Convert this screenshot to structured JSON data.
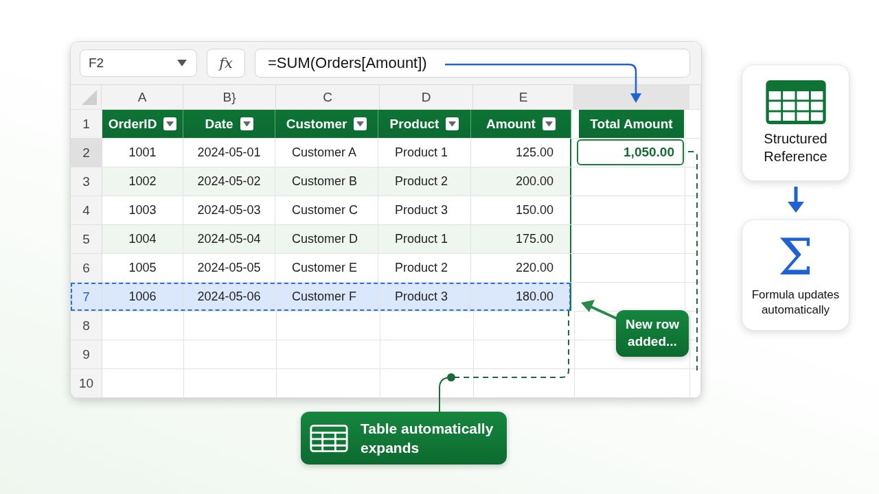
{
  "name_box": {
    "value": "F2"
  },
  "formula_bar": {
    "fx": "fx",
    "formula": "=SUM(Orders[Amount])"
  },
  "column_letters": [
    "A",
    "B}",
    "C",
    "D",
    "E"
  ],
  "table": {
    "header_row": "1",
    "headers": [
      "OrderID",
      "Date",
      "Customer",
      "Product",
      "Amount"
    ],
    "rows": [
      {
        "row": "2",
        "selected": true,
        "new": false,
        "cells": [
          "1001",
          "2024-05-01",
          "Customer A",
          "Product 1",
          "125.00"
        ]
      },
      {
        "row": "3",
        "selected": false,
        "new": false,
        "cells": [
          "1002",
          "2024-05-02",
          "Customer B",
          "Product 2",
          "200.00"
        ]
      },
      {
        "row": "4",
        "selected": false,
        "new": false,
        "cells": [
          "1003",
          "2024-05-03",
          "Customer C",
          "Product 3",
          "150.00"
        ]
      },
      {
        "row": "5",
        "selected": false,
        "new": false,
        "cells": [
          "1004",
          "2024-05-04",
          "Customer D",
          "Product 1",
          "175.00"
        ]
      },
      {
        "row": "6",
        "selected": false,
        "new": false,
        "cells": [
          "1005",
          "2024-05-05",
          "Customer E",
          "Product 2",
          "220.00"
        ]
      },
      {
        "row": "7",
        "selected": false,
        "new": true,
        "cells": [
          "1006",
          "2024-05-06",
          "Customer F",
          "Product 3",
          "180.00"
        ]
      }
    ]
  },
  "empty_rows": [
    "8",
    "9",
    "10"
  ],
  "total": {
    "header": "Total Amount",
    "value": "1,050.00"
  },
  "callouts": {
    "new_row": "New row added...",
    "expands": "Table automatically expands"
  },
  "cards": [
    {
      "kind": "table",
      "label": "Structured Reference"
    },
    {
      "kind": "glyph",
      "glyph": "Σ",
      "label": "Formula updates automatically"
    }
  ]
}
